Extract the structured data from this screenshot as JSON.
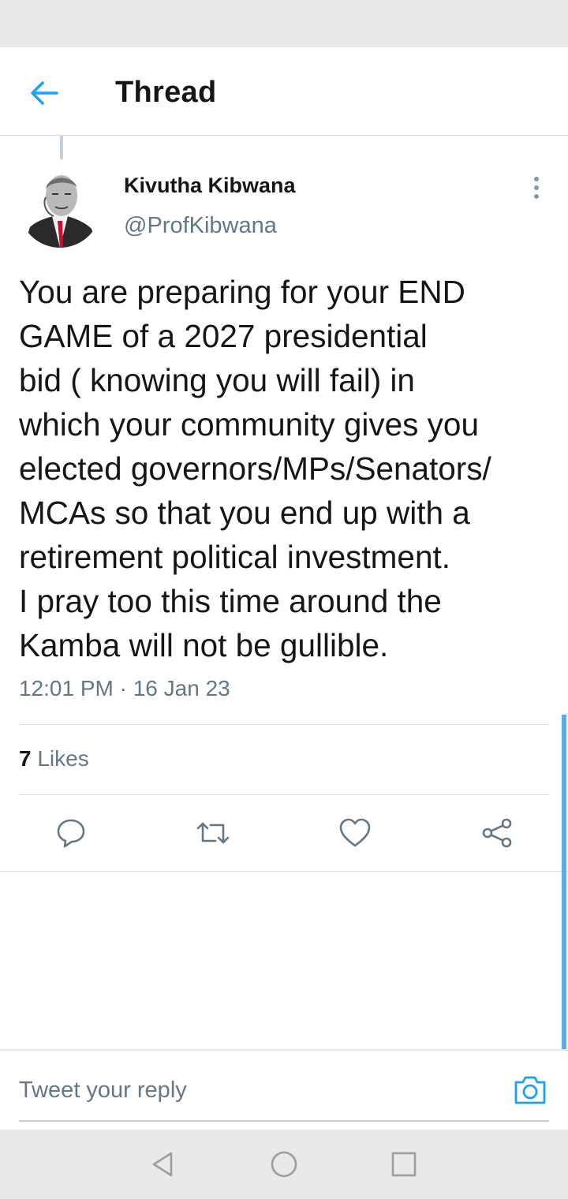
{
  "header": {
    "title": "Thread",
    "back_icon": "arrow-left-icon",
    "accent_color": "#1da1f2"
  },
  "tweet": {
    "author_name": "Kivutha Kibwana",
    "author_handle": "@ProfKibwana",
    "text_lines": [
      "You are preparing for your END",
      "GAME of a 2027 presidential",
      "bid ( knowing you will fail) in",
      "which your community gives you",
      "elected governors/MPs/Senators/",
      "MCAs so that you end up with a",
      "retirement political investment.",
      "I pray too this time around the",
      "Kamba will not be gullible."
    ],
    "timestamp": "12:01 PM · 16 Jan 23",
    "likes_count": "7",
    "likes_label": "Likes"
  },
  "actions": {
    "reply_icon": "reply-icon",
    "retweet_icon": "retweet-icon",
    "like_icon": "heart-icon",
    "share_icon": "share-icon"
  },
  "reply": {
    "placeholder": "Tweet your reply",
    "camera_icon": "camera-icon"
  },
  "nav": {
    "back": "nav-back-icon",
    "home": "nav-home-icon",
    "recents": "nav-recents-icon"
  }
}
